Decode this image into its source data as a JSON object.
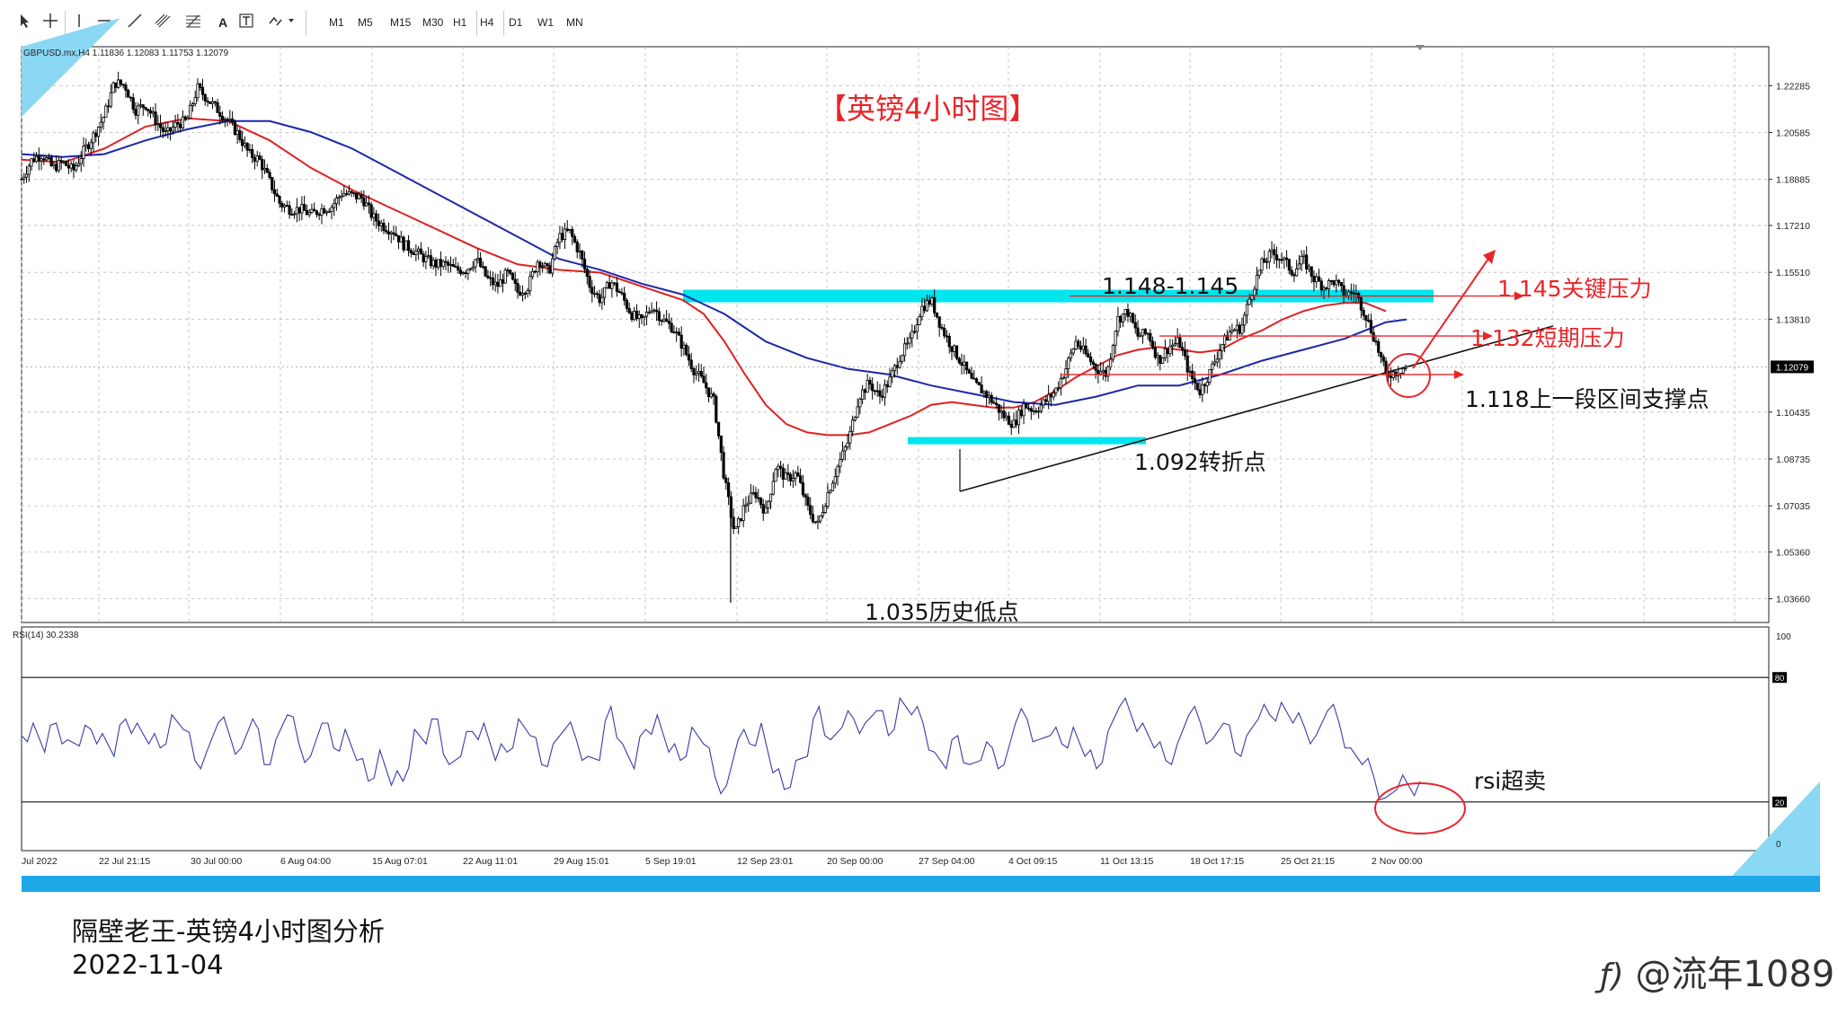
{
  "toolbar": {
    "tools": [
      "cursor-icon",
      "crosshair-icon",
      "vertical-line-icon",
      "horizontal-line-icon",
      "trendline-icon",
      "channel-icon",
      "fibonacci-icon",
      "text-icon",
      "text-label-icon",
      "arrows-icon"
    ],
    "text_tool_label": "A",
    "timeframes": [
      "M1",
      "M5",
      "M15",
      "M30",
      "H1",
      "H4",
      "D1",
      "W1",
      "MN"
    ]
  },
  "symbol_info": "GBPUSD.mx,H4  1.11836 1.12083 1.11753 1.12079",
  "rsi_info": "RSI(14) 30.2338",
  "title_annotation": "【英镑4小时图】",
  "annotations": {
    "range_label": "1.148-1.145",
    "key_resistance": "1.145关键压力",
    "short_resistance": "1.132短期压力",
    "support_point": "1.118上一段区间支撑点",
    "turning_point": "1.092转折点",
    "historical_low": "1.035历史低点",
    "rsi_oversold": "rsi超卖"
  },
  "colors": {
    "zone": "#00e5ee",
    "ma_red": "#e02020",
    "ma_blue": "#1a28a8",
    "annotation_red": "#e8262a",
    "rsi_line": "#3a3aa8",
    "accent_bar": "#1ea8e8"
  },
  "chart_data": [
    {
      "type": "candlestick",
      "symbol": "GBPUSD.mx",
      "timeframe": "H4",
      "ohlc_last": {
        "open": 1.11836,
        "high": 1.12083,
        "low": 1.11753,
        "close": 1.12079
      },
      "y_ticks": [
        "1.22285",
        "1.20585",
        "1.18885",
        "1.17210",
        "1.15510",
        "1.13810",
        "1.12079",
        "1.10435",
        "1.08735",
        "1.07035",
        "1.05360",
        "1.03660"
      ],
      "ylim": [
        1.028,
        1.237
      ],
      "x_ticks": [
        "Jul 2022",
        "22 Jul 21:15",
        "30 Jul 00:00",
        "6 Aug 04:00",
        "15 Aug 07:01",
        "22 Aug 11:01",
        "29 Aug 15:01",
        "5 Sep 19:01",
        "12 Sep 23:01",
        "20 Sep 00:00",
        "27 Sep 04:00",
        "4 Oct 09:15",
        "11 Oct 13:15",
        "18 Oct 17:15",
        "25 Oct 21:15",
        "2 Nov 00:00"
      ],
      "current_price": "1.12079",
      "price_path": [
        [
          0,
          1.189
        ],
        [
          0.5,
          1.196
        ],
        [
          1,
          1.198
        ],
        [
          1.5,
          1.193
        ],
        [
          2,
          1.195
        ],
        [
          2.5,
          1.192
        ],
        [
          3,
          1.199
        ],
        [
          3.5,
          1.205
        ],
        [
          4,
          1.212
        ],
        [
          4.5,
          1.224
        ],
        [
          5,
          1.223
        ],
        [
          5.5,
          1.214
        ],
        [
          6,
          1.216
        ],
        [
          6.5,
          1.21
        ],
        [
          7,
          1.205
        ],
        [
          7.5,
          1.209
        ],
        [
          8,
          1.21
        ],
        [
          8.5,
          1.222
        ],
        [
          9,
          1.218
        ],
        [
          9.5,
          1.214
        ],
        [
          10,
          1.21
        ],
        [
          10.5,
          1.205
        ],
        [
          11,
          1.198
        ],
        [
          11.5,
          1.196
        ],
        [
          12,
          1.188
        ],
        [
          12.5,
          1.18
        ],
        [
          13,
          1.178
        ],
        [
          13.5,
          1.178
        ],
        [
          14,
          1.176
        ],
        [
          14.5,
          1.178
        ],
        [
          15,
          1.179
        ],
        [
          15.5,
          1.184
        ],
        [
          16,
          1.183
        ],
        [
          16.5,
          1.182
        ],
        [
          17,
          1.175
        ],
        [
          17.5,
          1.172
        ],
        [
          18,
          1.17
        ],
        [
          18.5,
          1.165
        ],
        [
          19,
          1.163
        ],
        [
          19.5,
          1.16
        ],
        [
          20,
          1.158
        ],
        [
          20.5,
          1.158
        ],
        [
          21,
          1.156
        ],
        [
          21.5,
          1.156
        ],
        [
          22,
          1.16
        ],
        [
          22.5,
          1.153
        ],
        [
          23,
          1.15
        ],
        [
          23.5,
          1.155
        ],
        [
          24,
          1.148
        ],
        [
          24.5,
          1.15
        ],
        [
          25,
          1.16
        ],
        [
          25.5,
          1.155
        ],
        [
          26,
          1.168
        ],
        [
          26.5,
          1.17
        ],
        [
          27,
          1.162
        ],
        [
          27.5,
          1.15
        ],
        [
          28,
          1.145
        ],
        [
          28.5,
          1.152
        ],
        [
          29,
          1.147
        ],
        [
          29.5,
          1.14
        ],
        [
          30,
          1.137
        ],
        [
          30.5,
          1.143
        ],
        [
          31,
          1.138
        ],
        [
          31.5,
          1.135
        ],
        [
          32,
          1.128
        ],
        [
          32.5,
          1.12
        ],
        [
          33,
          1.115
        ],
        [
          33.5,
          1.108
        ],
        [
          34,
          1.08
        ],
        [
          34.5,
          1.06
        ],
        [
          35,
          1.071
        ],
        [
          35.5,
          1.075
        ],
        [
          36,
          1.068
        ],
        [
          36.5,
          1.085
        ],
        [
          37,
          1.08
        ],
        [
          37.5,
          1.082
        ],
        [
          38,
          1.07
        ],
        [
          38.5,
          1.063
        ],
        [
          39,
          1.075
        ],
        [
          39.5,
          1.085
        ],
        [
          40,
          1.094
        ],
        [
          40.5,
          1.11
        ],
        [
          41,
          1.115
        ],
        [
          41.5,
          1.11
        ],
        [
          42,
          1.116
        ],
        [
          42.5,
          1.125
        ],
        [
          43,
          1.13
        ],
        [
          43.5,
          1.142
        ],
        [
          44,
          1.145
        ],
        [
          44.5,
          1.135
        ],
        [
          45,
          1.128
        ],
        [
          45.5,
          1.122
        ],
        [
          46,
          1.115
        ],
        [
          46.5,
          1.112
        ],
        [
          47,
          1.108
        ],
        [
          47.5,
          1.103
        ],
        [
          48,
          1.1
        ],
        [
          48.5,
          1.107
        ],
        [
          49,
          1.105
        ],
        [
          49.5,
          1.108
        ],
        [
          50,
          1.112
        ],
        [
          50.5,
          1.12
        ],
        [
          51,
          1.13
        ],
        [
          51.5,
          1.125
        ],
        [
          52,
          1.12
        ],
        [
          52.5,
          1.118
        ],
        [
          53,
          1.138
        ],
        [
          53.5,
          1.141
        ],
        [
          54,
          1.132
        ],
        [
          54.5,
          1.133
        ],
        [
          55,
          1.123
        ],
        [
          55.5,
          1.128
        ],
        [
          56,
          1.13
        ],
        [
          56.5,
          1.118
        ],
        [
          57,
          1.112
        ],
        [
          57.5,
          1.119
        ],
        [
          58,
          1.128
        ],
        [
          58.5,
          1.134
        ],
        [
          59,
          1.135
        ],
        [
          59.5,
          1.148
        ],
        [
          60,
          1.158
        ],
        [
          60.5,
          1.162
        ],
        [
          61,
          1.16
        ],
        [
          61.5,
          1.155
        ],
        [
          62,
          1.16
        ],
        [
          62.5,
          1.153
        ],
        [
          63,
          1.15
        ],
        [
          63.5,
          1.152
        ],
        [
          64,
          1.147
        ],
        [
          64.5,
          1.148
        ],
        [
          65,
          1.14
        ],
        [
          65.5,
          1.13
        ],
        [
          66,
          1.118
        ],
        [
          66.5,
          1.119
        ],
        [
          67,
          1.121
        ]
      ],
      "ma_red_path": [
        [
          0,
          1.196
        ],
        [
          2,
          1.195
        ],
        [
          4,
          1.2
        ],
        [
          6,
          1.208
        ],
        [
          8,
          1.211
        ],
        [
          10,
          1.21
        ],
        [
          12,
          1.203
        ],
        [
          14,
          1.193
        ],
        [
          16,
          1.185
        ],
        [
          18,
          1.178
        ],
        [
          20,
          1.171
        ],
        [
          22,
          1.164
        ],
        [
          24,
          1.158
        ],
        [
          26,
          1.156
        ],
        [
          28,
          1.155
        ],
        [
          30,
          1.15
        ],
        [
          32,
          1.145
        ],
        [
          33,
          1.14
        ],
        [
          34,
          1.13
        ],
        [
          35,
          1.118
        ],
        [
          36,
          1.107
        ],
        [
          37,
          1.1
        ],
        [
          38,
          1.097
        ],
        [
          39,
          1.096
        ],
        [
          40,
          1.096
        ],
        [
          41,
          1.097
        ],
        [
          42,
          1.1
        ],
        [
          43,
          1.103
        ],
        [
          44,
          1.107
        ],
        [
          45,
          1.108
        ],
        [
          46,
          1.107
        ],
        [
          47,
          1.106
        ],
        [
          48,
          1.106
        ],
        [
          49,
          1.108
        ],
        [
          50,
          1.112
        ],
        [
          51,
          1.117
        ],
        [
          52,
          1.121
        ],
        [
          53,
          1.125
        ],
        [
          54,
          1.127
        ],
        [
          55,
          1.128
        ],
        [
          56,
          1.127
        ],
        [
          57,
          1.126
        ],
        [
          58,
          1.127
        ],
        [
          59,
          1.131
        ],
        [
          60,
          1.134
        ],
        [
          61,
          1.138
        ],
        [
          62,
          1.141
        ],
        [
          63,
          1.143
        ],
        [
          64,
          1.144
        ],
        [
          65,
          1.144
        ],
        [
          66,
          1.141
        ]
      ],
      "ma_blue_path": [
        [
          0,
          1.198
        ],
        [
          2,
          1.197
        ],
        [
          4,
          1.198
        ],
        [
          6,
          1.203
        ],
        [
          8,
          1.207
        ],
        [
          10,
          1.21
        ],
        [
          12,
          1.21
        ],
        [
          14,
          1.206
        ],
        [
          16,
          1.2
        ],
        [
          18,
          1.192
        ],
        [
          20,
          1.184
        ],
        [
          22,
          1.176
        ],
        [
          24,
          1.168
        ],
        [
          26,
          1.16
        ],
        [
          28,
          1.156
        ],
        [
          30,
          1.151
        ],
        [
          32,
          1.147
        ],
        [
          34,
          1.14
        ],
        [
          36,
          1.13
        ],
        [
          38,
          1.124
        ],
        [
          40,
          1.12
        ],
        [
          42,
          1.118
        ],
        [
          44,
          1.114
        ],
        [
          46,
          1.111
        ],
        [
          48,
          1.108
        ],
        [
          50,
          1.107
        ],
        [
          52,
          1.11
        ],
        [
          54,
          1.114
        ],
        [
          56,
          1.114
        ],
        [
          58,
          1.118
        ],
        [
          60,
          1.123
        ],
        [
          62,
          1.127
        ],
        [
          64,
          1.131
        ],
        [
          66,
          1.137
        ],
        [
          67,
          1.138
        ]
      ]
    },
    {
      "type": "line",
      "indicator": "RSI(14)",
      "value": 30.2338,
      "y_ticks": [
        "100",
        "80",
        "20",
        "0"
      ],
      "levels": [
        80,
        20
      ],
      "ylim": [
        0,
        100
      ],
      "series": [
        {
          "values": [
            52,
            58,
            44,
            58,
            50,
            47,
            55,
            53,
            42,
            60,
            58,
            48,
            46,
            62,
            55,
            40,
            44,
            58,
            52,
            46,
            60,
            38,
            50,
            62,
            48,
            42,
            58,
            46,
            55,
            40,
            30,
            45,
            28,
            30,
            55,
            48,
            60,
            38,
            42,
            54,
            58,
            40,
            44,
            60,
            52,
            38,
            48,
            55,
            50,
            42,
            40,
            66,
            48,
            36,
            55,
            62,
            44,
            40,
            56,
            48,
            32,
            28,
            50,
            48,
            58,
            34,
            26,
            40,
            42,
            66,
            50,
            56,
            60,
            58,
            64,
            52,
            70,
            62,
            58,
            44,
            36,
            52,
            38,
            40,
            46,
            38,
            58,
            60,
            50,
            52,
            48,
            56,
            42,
            36,
            54,
            66,
            62,
            58,
            46,
            40,
            48,
            62,
            58,
            50,
            58,
            44,
            52,
            60,
            62,
            68,
            58,
            56,
            52,
            64,
            58,
            46,
            38,
            32,
            22,
            26,
            28,
            30
          ]
        }
      ]
    }
  ],
  "footer": {
    "title": "隔壁老王-英镑4小时图分析",
    "date": "2022-11-04",
    "watermark": "@流年1089"
  }
}
